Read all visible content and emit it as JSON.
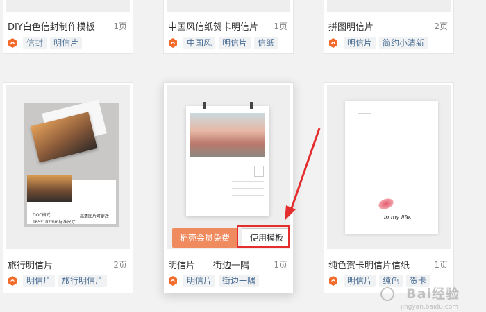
{
  "top_cards": [
    {
      "title": "DIY白色信封制作模板",
      "pages": "1页",
      "tags": [
        "信封",
        "明信片"
      ]
    },
    {
      "title": "中国风信纸贺卡明信片",
      "pages": "1页",
      "tags": [
        "中国风",
        "明信片",
        "信纸"
      ]
    },
    {
      "title": "拼图明信片",
      "pages": "2页",
      "tags": [
        "明信片",
        "简约小清新"
      ]
    }
  ],
  "bottom_cards": [
    {
      "title": "旅行明信片",
      "pages": "2页",
      "tags": [
        "明信片",
        "旅行明信片"
      ],
      "thumb_text": {
        "caption_a": "DOC格式",
        "caption_b": "165*102mm标准尺寸",
        "caption_c": "高清图片可更改"
      }
    },
    {
      "title": "明信片——街边一隅",
      "pages": "1页",
      "tags": [
        "明信片",
        "街边一隅"
      ],
      "free_button": "稻壳会员免费",
      "use_button": "使用模板"
    },
    {
      "title": "纯色贺卡明信片信纸",
      "pages": "1页",
      "tags": [
        "明信片",
        "纯色",
        "贺卡"
      ],
      "thumb_text": {
        "script": "in my life."
      }
    }
  ],
  "colors": {
    "accent": "#f08b5f",
    "brand_icon": "#f26b2a",
    "tag_text": "#4c6f95",
    "highlight": "#e42d2d"
  },
  "watermark": {
    "text": "Bai经验",
    "sub": "jingyan.baidu.com"
  }
}
